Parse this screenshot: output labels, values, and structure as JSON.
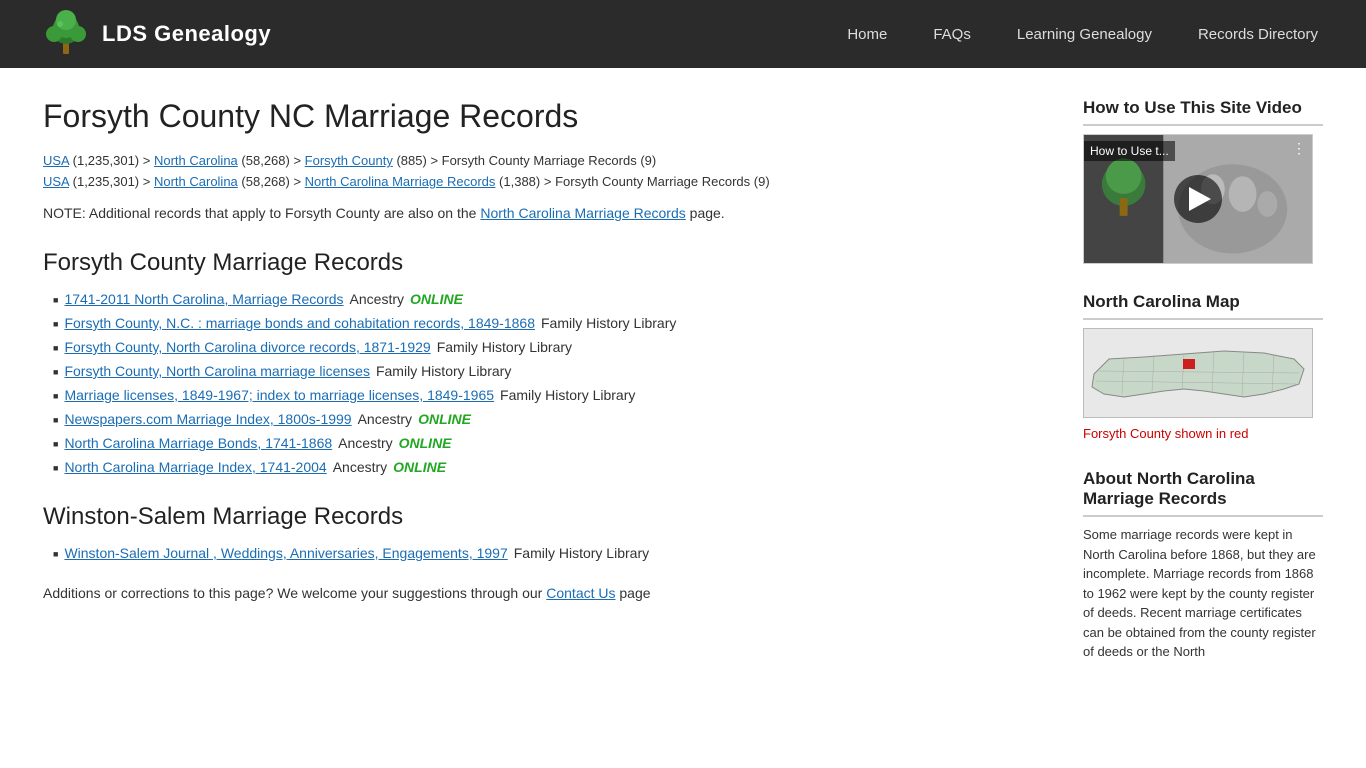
{
  "header": {
    "logo_text": "LDS Genealogy",
    "nav_items": [
      "Home",
      "FAQs",
      "Learning Genealogy",
      "Records Directory"
    ]
  },
  "page": {
    "title": "Forsyth County NC Marriage Records",
    "breadcrumb1": {
      "usa": "USA",
      "usa_count": "(1,235,301)",
      "nc": "North Carolina",
      "nc_count": "(58,268)",
      "forsyth": "Forsyth County",
      "forsyth_count": "(885)",
      "end": "> Forsyth County Marriage Records (9)"
    },
    "breadcrumb2": {
      "usa": "USA",
      "usa_count": "(1,235,301)",
      "nc": "North Carolina",
      "nc_count": "(58,268)",
      "nc_marriage": "North Carolina Marriage Records",
      "nc_marriage_count": "(1,388)",
      "end": "> Forsyth County Marriage Records (9)"
    },
    "note": "NOTE: Additional records that apply to Forsyth County are also on the",
    "note_link": "North Carolina Marriage Records",
    "note_end": "page.",
    "section1_title": "Forsyth County Marriage Records",
    "records1": [
      {
        "link": "1741-2011 North Carolina, Marriage Records",
        "provider": "Ancestry",
        "online": true
      },
      {
        "link": "Forsyth County, N.C. : marriage bonds and cohabitation records, 1849-1868",
        "provider": "Family History Library",
        "online": false
      },
      {
        "link": "Forsyth County, North Carolina divorce records, 1871-1929",
        "provider": "Family History Library",
        "online": false
      },
      {
        "link": "Forsyth County, North Carolina marriage licenses",
        "provider": "Family History Library",
        "online": false
      },
      {
        "link": "Marriage licenses, 1849-1967; index to marriage licenses, 1849-1965",
        "provider": "Family History Library",
        "online": false
      },
      {
        "link": "Newspapers.com Marriage Index, 1800s-1999",
        "provider": "Ancestry",
        "online": true
      },
      {
        "link": "North Carolina Marriage Bonds, 1741-1868",
        "provider": "Ancestry",
        "online": true
      },
      {
        "link": "North Carolina Marriage Index, 1741-2004",
        "provider": "Ancestry",
        "online": true
      }
    ],
    "section2_title": "Winston-Salem Marriage Records",
    "records2": [
      {
        "link": "Winston-Salem Journal , Weddings, Anniversaries, Engagements, 1997",
        "provider": "Family History Library",
        "online": false
      }
    ],
    "online_text": "ONLINE",
    "footer_note": "Additions or corrections to this page? We welcome your suggestions through our",
    "footer_link": "Contact Us",
    "footer_end": "page"
  },
  "sidebar": {
    "video_section_title": "How to Use This Site Video",
    "video_title_overlay": "How to Use t...",
    "map_section_title": "North Carolina Map",
    "map_caption_normal": "Forsyth County shown in",
    "map_caption_color": "red",
    "about_section_title": "About North Carolina Marriage Records",
    "about_text": "Some marriage records were kept in North Carolina before 1868, but they are incomplete. Marriage records from 1868 to 1962 were kept by the county register of deeds. Recent marriage certificates can be obtained from the county register of deeds or the North"
  }
}
